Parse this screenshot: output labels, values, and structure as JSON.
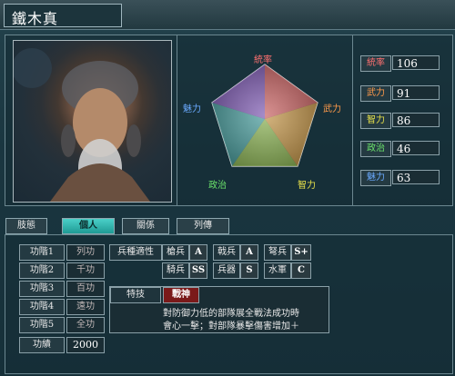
{
  "character": {
    "name": "鐵木真"
  },
  "radar": {
    "axes": [
      "統率",
      "武力",
      "智力",
      "政治",
      "魅力"
    ],
    "colors": {
      "統率": "#ff6a6a",
      "武力": "#ff8a3a",
      "智力": "#e0e040",
      "政治": "#6adf6a",
      "魅力": "#5aaaff"
    }
  },
  "stats": [
    {
      "label": "統率",
      "value": "106",
      "color": "#ff7070"
    },
    {
      "label": "武力",
      "value": "91",
      "color": "#ff9a4a"
    },
    {
      "label": "智力",
      "value": "86",
      "color": "#e6e04a"
    },
    {
      "label": "政治",
      "value": "46",
      "color": "#6ae06a"
    },
    {
      "label": "魅力",
      "value": "63",
      "color": "#6aaaff"
    }
  ],
  "tabs": [
    "肢態",
    "個人",
    "關係",
    "列傳"
  ],
  "active_tab": "個人",
  "grades": [
    {
      "label": "功階1",
      "value": "列功"
    },
    {
      "label": "功階2",
      "value": "千功"
    },
    {
      "label": "功階3",
      "value": "百功"
    },
    {
      "label": "功階4",
      "value": "遠功"
    },
    {
      "label": "功階5",
      "value": "全功"
    }
  ],
  "merit": {
    "label": "功績",
    "value": "2000"
  },
  "aptitude": {
    "label": "兵種適性",
    "items": [
      {
        "name": "槍兵",
        "grade": "A"
      },
      {
        "name": "戟兵",
        "grade": "A"
      },
      {
        "name": "弩兵",
        "grade": "S+"
      },
      {
        "name": "騎兵",
        "grade": "SS"
      },
      {
        "name": "兵器",
        "grade": "S"
      },
      {
        "name": "水軍",
        "grade": "C"
      }
    ]
  },
  "special": {
    "label": "特技",
    "name": "戰神",
    "description_1": "對防御力低的部隊展全戰法成功時",
    "description_2": "會心一擊；對部隊暴擊傷害增加＋"
  }
}
